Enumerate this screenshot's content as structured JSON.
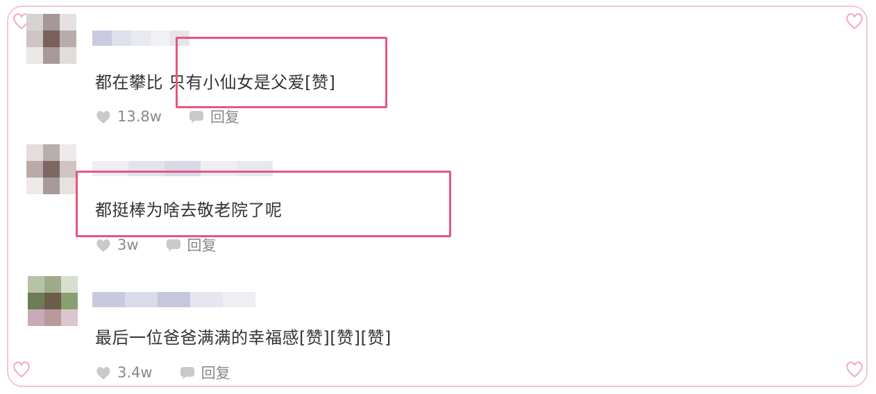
{
  "comments": [
    {
      "text": "都在攀比 只有小仙女是父爱[赞]",
      "likes": "13.8w",
      "reply_label": "回复",
      "avatar_colors": [
        "#d8d2d1",
        "#a59897",
        "#e6e1e0",
        "#cfc4c3",
        "#7a5f5c",
        "#b9adac",
        "#ece8e8",
        "#a89998",
        "#e2dcdb"
      ],
      "name_colors": [
        "#c9cbe0",
        "#dfe0ee",
        "#e9e9f2",
        "#f0f0f5",
        "#e5e5ec"
      ]
    },
    {
      "text": "都挺棒为啥去敬老院了呢",
      "likes": "3w",
      "reply_label": "回复",
      "avatar_colors": [
        "#e4dedd",
        "#b8aeac",
        "#efeaea",
        "#b9a9a7",
        "#7d6763",
        "#cfc4c3",
        "#eeeaea",
        "#a89a98",
        "#e7e2e1"
      ],
      "name_colors": [
        "#eeeef4",
        "#e3e3ee",
        "#d9dae8",
        "#eeeef4",
        "#e8e8f0"
      ]
    },
    {
      "text": "最后一位爸爸满满的幸福感[赞][赞][赞]",
      "likes": "3.4w",
      "reply_label": "回复",
      "avatar_colors": [
        "#b6c2a6",
        "#9eab8b",
        "#d8dfcf",
        "#6c7d55",
        "#6b5d4a",
        "#8aa071",
        "#c9a9b9",
        "#b89a9c",
        "#d9c6cf"
      ],
      "name_colors": [
        "#c8c9de",
        "#dadbe9",
        "#c6c7dc",
        "#e6e6ef",
        "#eeeef4"
      ]
    }
  ],
  "colors": {
    "highlight": "#e8557a",
    "frame": "#f4c6d2"
  },
  "icons": [
    "heart-icon",
    "comment-bubble-icon",
    "corner-heart-icon"
  ]
}
